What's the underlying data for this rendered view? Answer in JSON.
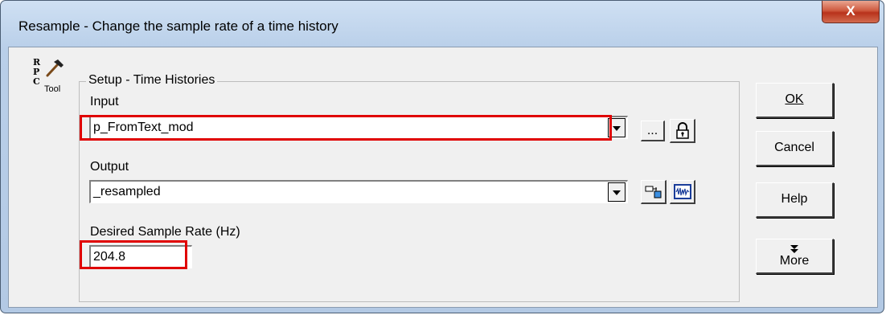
{
  "window": {
    "title": "Resample - Change the sample rate of a time history",
    "close_glyph": "X"
  },
  "logo": {
    "letters": [
      "R",
      "P",
      "C"
    ],
    "tool_label": "Tool",
    "icon": "hammer-icon"
  },
  "setup": {
    "group_title": "Setup - Time Histories",
    "input_label": "Input",
    "input_value": "p_FromText_mod",
    "browse_label": "...",
    "output_label": "Output",
    "output_value": "_resampled",
    "rate_label": "Desired Sample Rate (Hz)",
    "rate_value": "204.8"
  },
  "buttons": {
    "ok_label": "OK",
    "ok_mnemonic": "K",
    "cancel_label": "Cancel",
    "help_label": "Help",
    "more_label": "More"
  },
  "colors": {
    "highlight": "#e00000",
    "title_bar": "#b9cfe9",
    "close_button": "#c7442b"
  }
}
